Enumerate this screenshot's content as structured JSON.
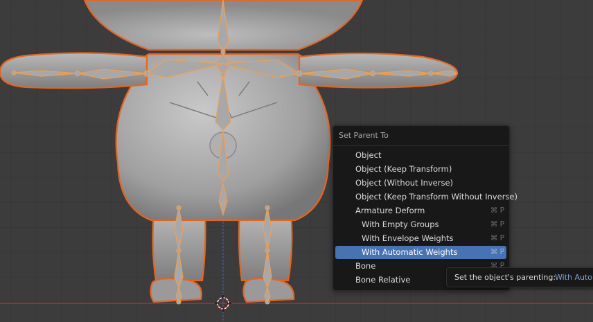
{
  "menu": {
    "title": "Set Parent To",
    "items": [
      {
        "label": "Object",
        "shortcut": ""
      },
      {
        "label": "Object (Keep Transform)",
        "shortcut": ""
      },
      {
        "label": "Object (Without Inverse)",
        "shortcut": ""
      },
      {
        "label": "Object (Keep Transform Without Inverse)",
        "shortcut": ""
      },
      {
        "label": "Armature Deform",
        "shortcut": "⌘ P"
      },
      {
        "label": "With Empty Groups",
        "shortcut": "⌘ P"
      },
      {
        "label": "With Envelope Weights",
        "shortcut": "⌘ P"
      },
      {
        "label": "With Automatic Weights",
        "shortcut": "⌘ P"
      },
      {
        "label": "Bone",
        "shortcut": "⌘ P"
      },
      {
        "label": "Bone Relative",
        "shortcut": ""
      }
    ]
  },
  "tooltip": {
    "text": "Set the object's parenting:",
    "value": "With Autom"
  },
  "colors": {
    "viewport_bg": "#3c3c3c",
    "selection_outline": "#e8641e",
    "bone_active": "#f0a050",
    "menu_highlight": "#4772b3",
    "x_axis": "#a83a3a",
    "z_axis": "#4060a8"
  }
}
